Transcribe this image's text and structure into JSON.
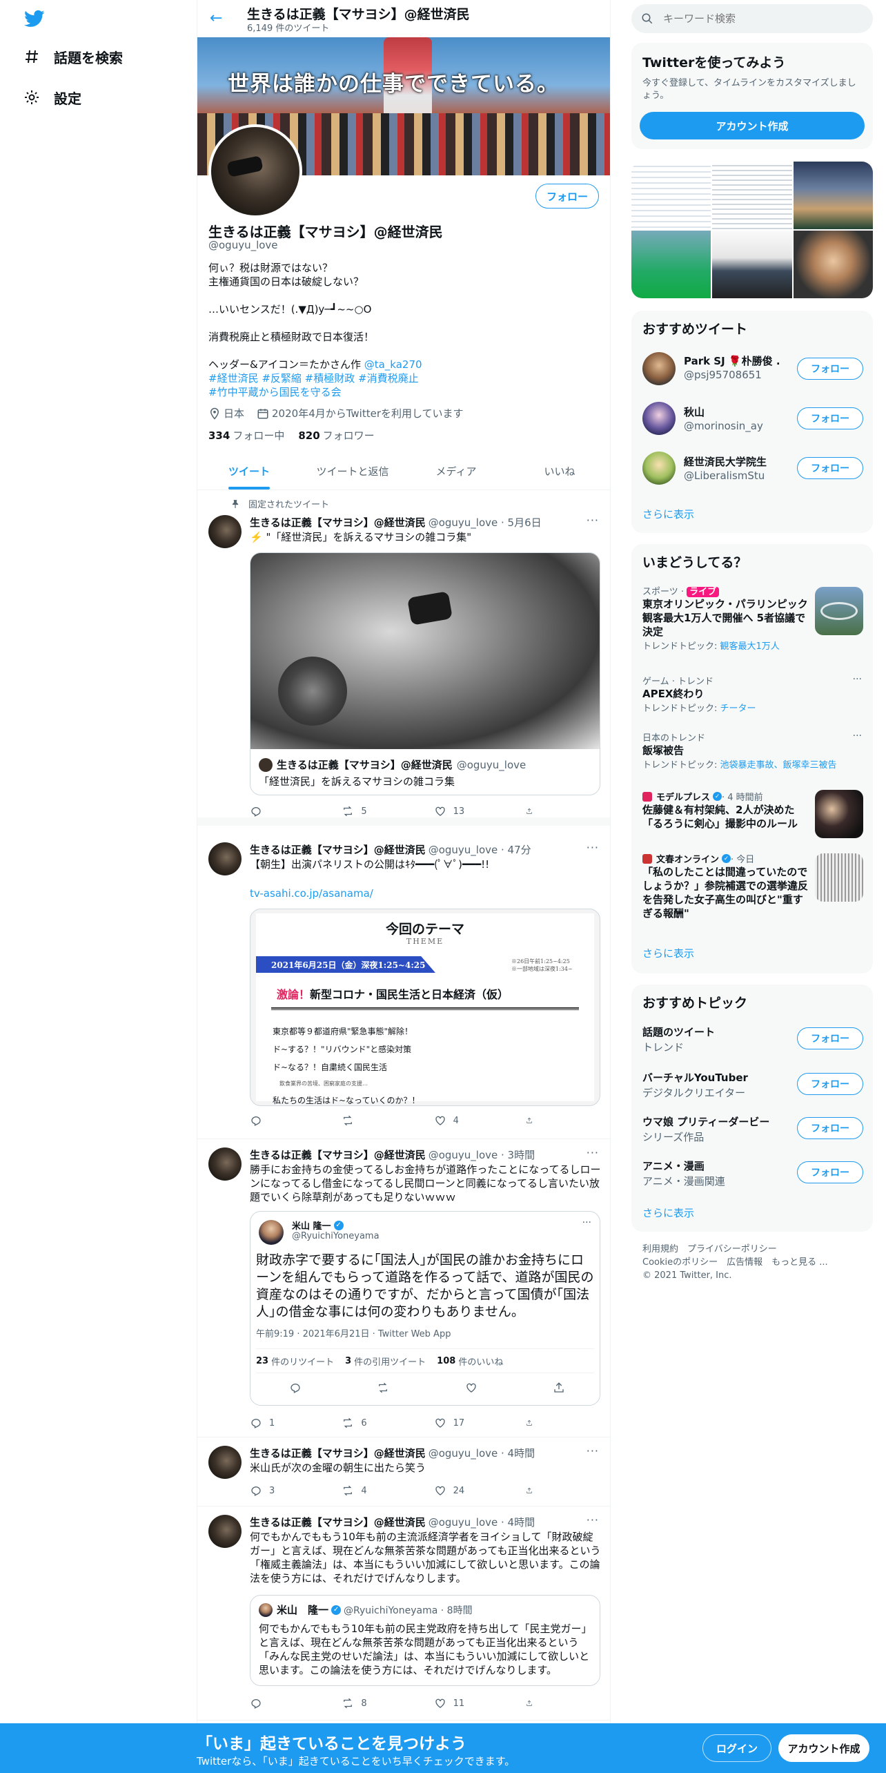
{
  "nav": {
    "explore": "話題を検索",
    "settings": "設定"
  },
  "header": {
    "name": "生きるは正義【マサヨシ】@経世済民",
    "tweet_count": "6,149 件のツイート"
  },
  "banner": {
    "text": "世界は誰かの仕事でできている。"
  },
  "profile": {
    "name": "生きるは正義【マサヨシ】@経世済民",
    "handle": "@oguyu_love",
    "follow": "フォロー",
    "bio": [
      "何ぃ？税は財源ではない？",
      "主権通貨国の日本は破綻しない？",
      "",
      "…いいセンスだ！(.▼Д)y─┛~~○O",
      "",
      "消費税廃止と積極財政で日本復活！",
      "",
      "ヘッダー&アイコン＝たかさん作 "
    ],
    "bio_link": "@ta_ka270",
    "hashtags1": "#経世済民 #反緊縮 #積極財政 #消費税廃止",
    "hashtags2": "#竹中平蔵から国民を守る会",
    "location": "日本",
    "joined": "2020年4月からTwitterを利用しています",
    "following_count": "334",
    "following_label": "フォロー中",
    "followers_count": "820",
    "followers_label": "フォロワー"
  },
  "tabs": [
    "ツイート",
    "ツイートと返信",
    "メディア",
    "いいね"
  ],
  "pinned_label": "固定されたツイート",
  "tweets": [
    {
      "name": "生きるは正義【マサヨシ】@経世済民",
      "meta": "@oguyu_love · 5月6日",
      "text": "⚡️ \"「経世済民」を訴えるマサヨシの雑コラ集\"",
      "card_name": "生きるは正義【マサヨシ】@経世済民",
      "card_handle": "@oguyu_love",
      "card_text": "「経世済民」を訴えるマサヨシの雑コラ集",
      "reply": "",
      "retweet": "5",
      "like": "13"
    },
    {
      "name": "生きるは正義【マサヨシ】@経世済民",
      "meta": "@oguyu_love · 47分",
      "text": "【朝生】出演パネリストの公開はｷﾀ━━━(ﾟ∀ﾟ)━━━!!",
      "link": "tv-asahi.co.jp/asanama/",
      "img": {
        "title": "今回のテーマ",
        "theme": "THEME",
        "date": "2021年6月25日（金）深夜1:25~4:25",
        "note1": "※26日午前1:25~4:25",
        "note2": "※一部地域は深夜1:34~",
        "headline_red": "激論！",
        "headline": "新型コロナ・国民生活と日本経済（仮）",
        "l1": "東京都等９都道府県\"緊急事態\"解除！",
        "l2": "ド~する？！\"リバウンド\"と感染対策",
        "l3": "ド~なる？！自粛続く国民生活",
        "l4": "飲食業界の苦境、困窮家庭の支援…",
        "l5": "私たちの生活はド~なっていくのか？！"
      },
      "reply": "",
      "retweet": "",
      "like": "4"
    },
    {
      "name": "生きるは正義【マサヨシ】@経世済民",
      "meta": "@oguyu_love · 3時間",
      "text": "勝手にお金持ちの金使ってるしお金持ちが道路作ったことになってるしローンになってるし借金になってるし民間ローンと同義になってるし言いたい放題でいくら除草剤があっても足りないｗｗｗ",
      "quote": {
        "name": "米山 隆一",
        "handle": "@RyuichiYoneyama",
        "text": "財政赤字で要するに｢国法人｣が国民の誰かお金持ちにローンを組んでもらって道路を作るって話で、道路が国民の資産なのはその通りですが、だからと言って国債が｢国法人｣の借金な事には何の変わりもありません。",
        "time": "午前9:19 · 2021年6月21日 · Twitter Web App",
        "rt_count": "23",
        "rt_label": "件のリツイート",
        "q_count": "3",
        "q_label": "件の引用ツイート",
        "l_count": "108",
        "l_label": "件のいいね"
      },
      "reply": "1",
      "retweet": "6",
      "like": "17"
    },
    {
      "name": "生きるは正義【マサヨシ】@経世済民",
      "meta": "@oguyu_love · 4時間",
      "text": "米山氏が次の金曜の朝生に出たら笑う",
      "reply": "3",
      "retweet": "4",
      "like": "24"
    },
    {
      "name": "生きるは正義【マサヨシ】@経世済民",
      "meta": "@oguyu_love · 4時間",
      "text": "何でもかんでももう10年も前の主流派経済学者をヨイショして「財政破綻ガー」と言えば、現在どんな無茶苦茶な問題があっても正当化出来るという「権威主義論法」は、本当にもういい加減にして欲しいと思います。この論法を使う方には、それだけでげんなりします。",
      "quote": {
        "name": "米山　隆一",
        "handle": "@RyuichiYoneyama · 8時間",
        "text": "何でもかんでももう10年も前の民主党政府を持ち出して「民主党ガー」と言えば、現在どんな無茶苦茶な問題があっても正当化出来るという「みんな民主党のせいだ論法」は、本当にもういい加減にして欲しいと思います。この論法を使う方には、それだけでげんなりします。"
      },
      "reply": "",
      "retweet": "8",
      "like": "11"
    }
  ],
  "right": {
    "search_placeholder": "キーワード検索",
    "signup": {
      "title": "Twitterを使ってみよう",
      "desc": "今すぐ登録して、タイムラインをカスタマイズしましょう。",
      "button": "アカウント作成"
    },
    "who": {
      "title": "おすすめツイート",
      "users": [
        {
          "name": "Park SJ 🌹朴勝俊 ...",
          "handle": "@psj95708651"
        },
        {
          "name": "秋山",
          "handle": "@morinosin_ay"
        },
        {
          "name": "経世済民大学院生",
          "handle": "@LiberalismStu"
        }
      ],
      "follow": "フォロー",
      "more": "さらに表示"
    },
    "trends": {
      "title": "いまどうしてる？",
      "items": [
        {
          "cat": "スポーツ · ",
          "live": "ライブ",
          "title": "東京オリンピック・パラリンピック 観客最大1万人で開催へ 5者協議で決定",
          "sub_label": "トレンドトピック: ",
          "sub_link": "観客最大1万人"
        },
        {
          "cat": "ゲーム · トレンド",
          "title": "APEX終わり",
          "sub_label": "トレンドトピック: ",
          "sub_link": "チーター"
        },
        {
          "cat": "日本のトレンド",
          "title": "飯塚被告",
          "sub_label": "トレンドトピック: ",
          "sub_link": "池袋暴走事故、飯塚幸三被告"
        },
        {
          "cat": "モデルプレス",
          "cat_time": " · 4 時間前",
          "title": "佐藤健＆有村架純、2人が決めた「るろうに剣心」撮影中のルール"
        },
        {
          "cat": "文春オンライン",
          "cat_time": " · 今日",
          "title": "「私のしたことは間違っていたのでしょうか？」参院補選での選挙違反を告発した女子高生の叫びと\"重すぎる報酬\""
        }
      ],
      "more": "さらに表示"
    },
    "topics": {
      "title": "おすすめトピック",
      "items": [
        {
          "title": "話題のツイート",
          "sub": "トレンド"
        },
        {
          "title": "バーチャルYouTuber",
          "sub": "デジタルクリエイター"
        },
        {
          "title": "ウマ娘 プリティーダービー",
          "sub": "シリーズ作品"
        },
        {
          "title": "アニメ・漫画",
          "sub": "アニメ・漫画関連"
        }
      ],
      "follow": "フォロー",
      "more": "さらに表示"
    },
    "footer": {
      "l1": "利用規約　プライバシーポリシー",
      "l2": "Cookieのポリシー　広告情報　もっと見る ...",
      "l3": "© 2021 Twitter, Inc."
    }
  },
  "bottom": {
    "title": "「いま」起きていることを見つけよう",
    "sub": "Twitterなら、「いま」起きていることをいち早くチェックできます。",
    "login": "ログイン",
    "signup": "アカウント作成"
  },
  "colors": {
    "accent": "#1d9bf0",
    "live": "#f91880"
  }
}
